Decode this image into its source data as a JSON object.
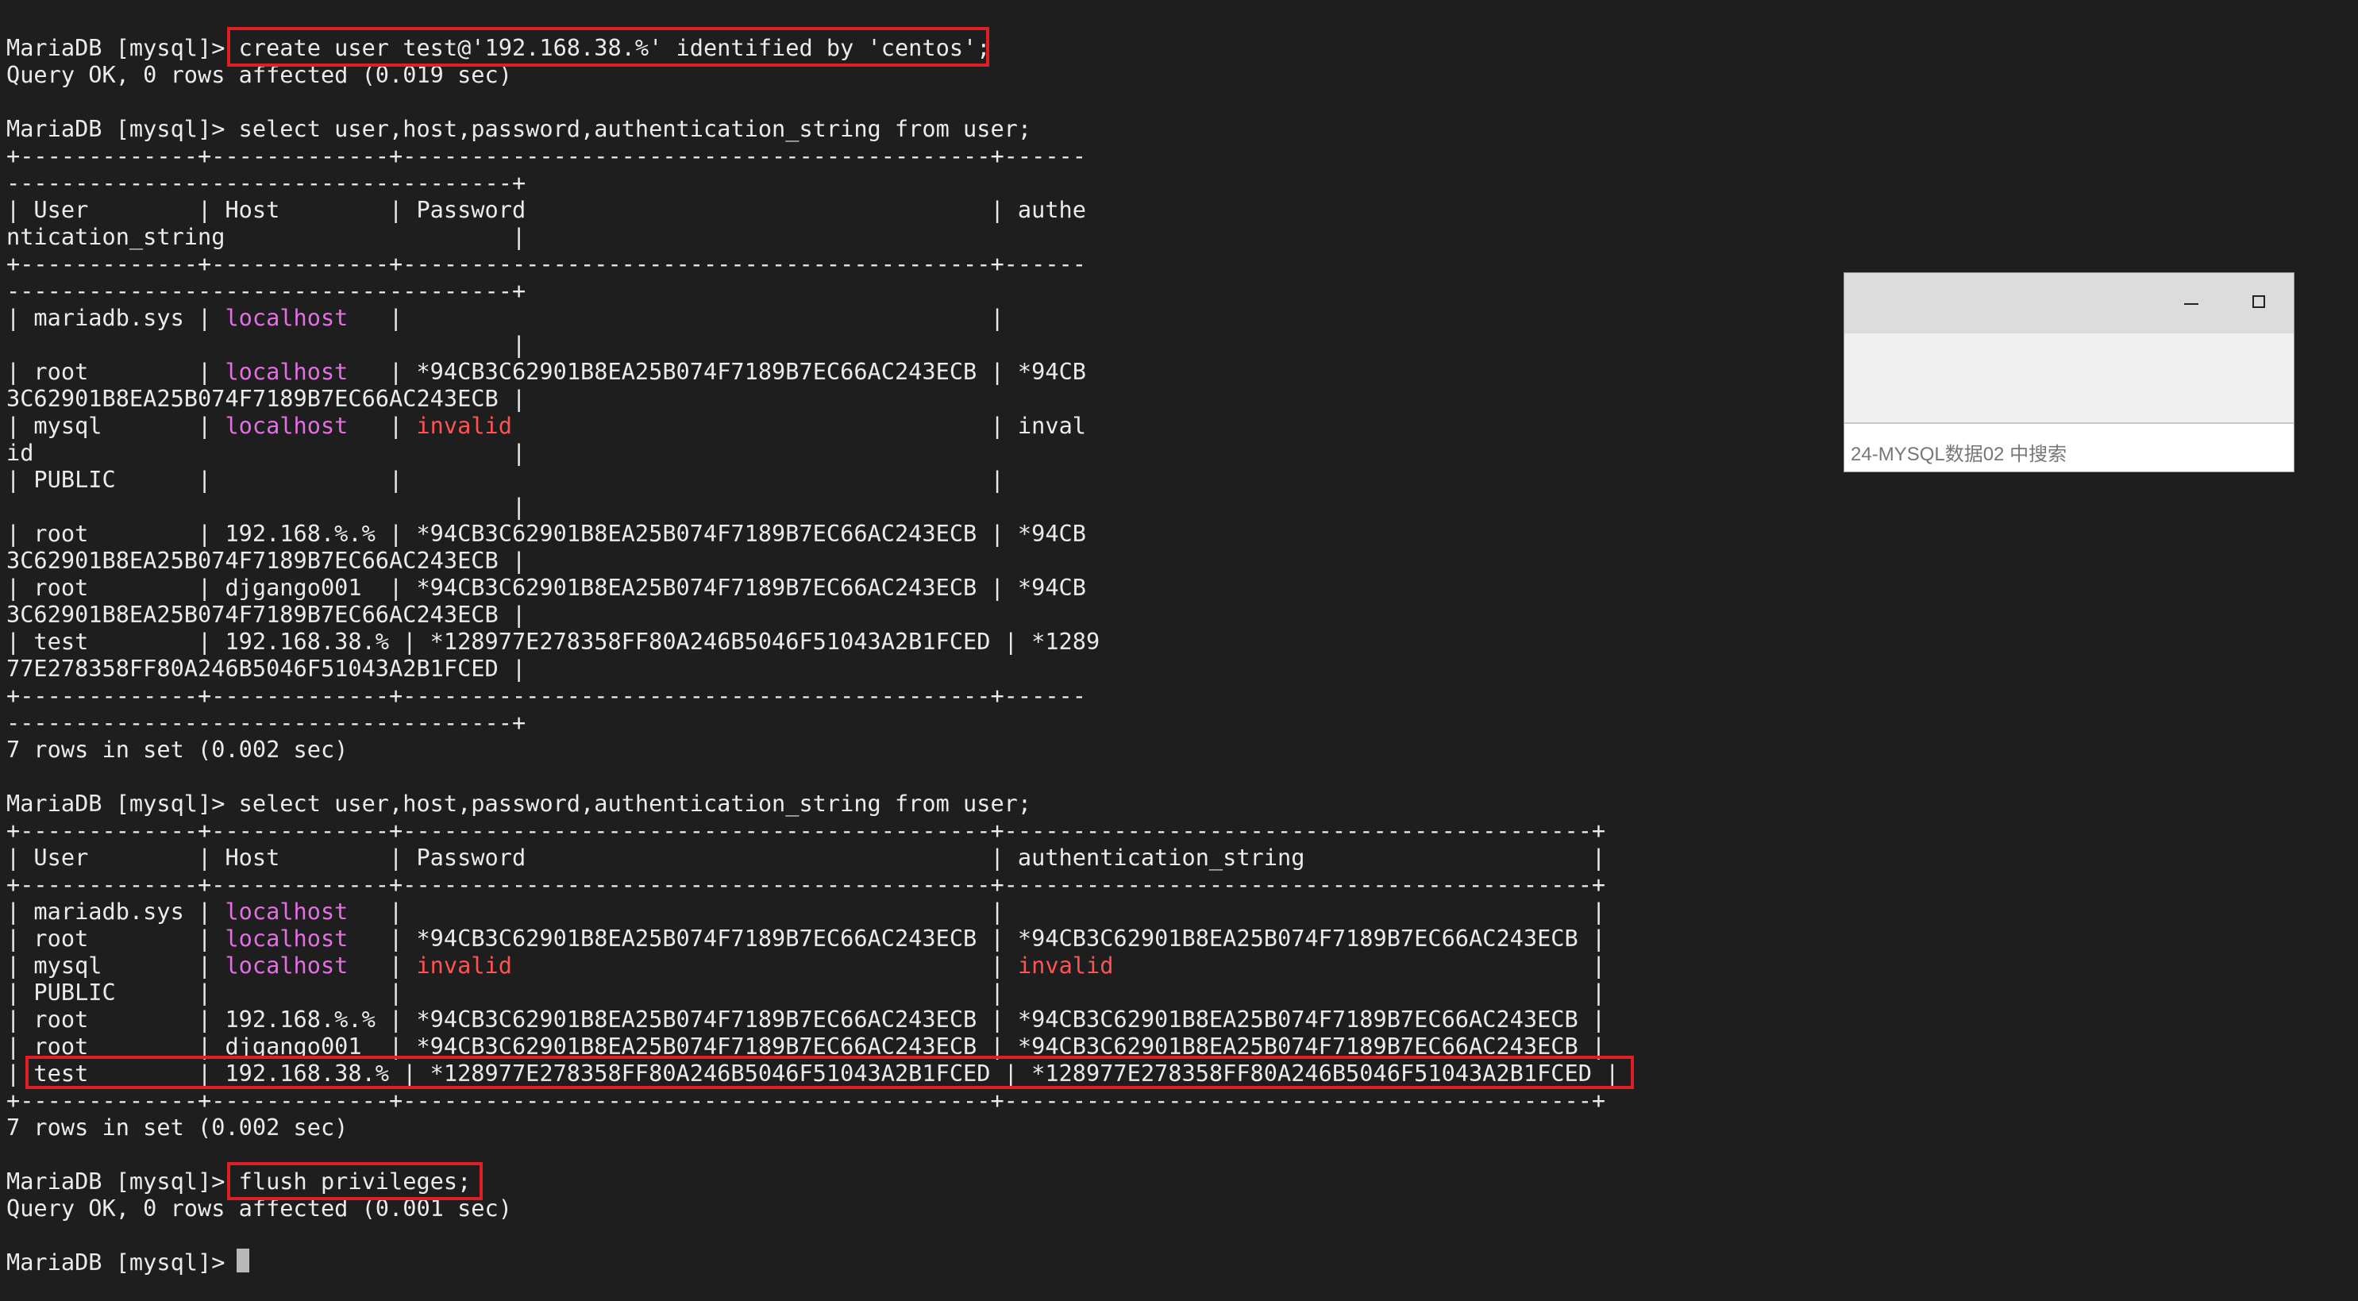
{
  "terminal": {
    "lines": [
      [
        {
          "t": "MariaDB [mysql]> create user test@'192.168.38.%' identified by 'centos';"
        }
      ],
      [
        {
          "t": "Query OK, 0 rows affected (0.019 sec)"
        }
      ],
      [
        {
          "t": ""
        }
      ],
      [
        {
          "t": "MariaDB [mysql]> select user,host,password,authentication_string from user;"
        }
      ],
      [
        {
          "t": "+-------------+-------------+-------------------------------------------+------"
        }
      ],
      [
        {
          "t": "-------------------------------------+"
        }
      ],
      [
        {
          "t": "| User        | Host        | Password                                  | authe"
        }
      ],
      [
        {
          "t": "ntication_string                     |"
        }
      ],
      [
        {
          "t": "+-------------+-------------+-------------------------------------------+------"
        }
      ],
      [
        {
          "t": "-------------------------------------+"
        }
      ],
      [
        {
          "t": "| mariadb.sys | "
        },
        {
          "t": "localhost",
          "c": "m"
        },
        {
          "t": "   |                                           |"
        }
      ],
      [
        {
          "t": "                                     |"
        }
      ],
      [
        {
          "t": "| root        | "
        },
        {
          "t": "localhost",
          "c": "m"
        },
        {
          "t": "   | *94CB3C62901B8EA25B074F7189B7EC66AC243ECB | *94CB"
        }
      ],
      [
        {
          "t": "3C62901B8EA25B074F7189B7EC66AC243ECB |"
        }
      ],
      [
        {
          "t": "| mysql       | "
        },
        {
          "t": "localhost",
          "c": "m"
        },
        {
          "t": "   | "
        },
        {
          "t": "invalid",
          "c": "r"
        },
        {
          "t": "                                   | inval"
        }
      ],
      [
        {
          "t": "id                                   |"
        }
      ],
      [
        {
          "t": "| PUBLIC      |             |                                           |"
        }
      ],
      [
        {
          "t": "                                     |"
        }
      ],
      [
        {
          "t": "| root        | 192.168.%.% | *94CB3C62901B8EA25B074F7189B7EC66AC243ECB | *94CB"
        }
      ],
      [
        {
          "t": "3C62901B8EA25B074F7189B7EC66AC243ECB |"
        }
      ],
      [
        {
          "t": "| root        | djgango001  | *94CB3C62901B8EA25B074F7189B7EC66AC243ECB | *94CB"
        }
      ],
      [
        {
          "t": "3C62901B8EA25B074F7189B7EC66AC243ECB |"
        }
      ],
      [
        {
          "t": "| test        | 192.168.38.% | *128977E278358FF80A246B5046F51043A2B1FCED | *1289"
        }
      ],
      [
        {
          "t": "77E278358FF80A246B5046F51043A2B1FCED |"
        }
      ],
      [
        {
          "t": "+-------------+-------------+-------------------------------------------+------"
        }
      ],
      [
        {
          "t": "-------------------------------------+"
        }
      ],
      [
        {
          "t": "7 rows in set (0.002 sec)"
        }
      ],
      [
        {
          "t": ""
        }
      ],
      [
        {
          "t": "MariaDB [mysql]> select user,host,password,authentication_string from user;"
        }
      ],
      [
        {
          "t": "+-------------+-------------+-------------------------------------------+-------------------------------------------+"
        }
      ],
      [
        {
          "t": "| User        | Host        | Password                                  | authentication_string                     |"
        }
      ],
      [
        {
          "t": "+-------------+-------------+-------------------------------------------+-------------------------------------------+"
        }
      ],
      [
        {
          "t": "| mariadb.sys | "
        },
        {
          "t": "localhost",
          "c": "m"
        },
        {
          "t": "   |                                           |                                           |"
        }
      ],
      [
        {
          "t": "| root        | "
        },
        {
          "t": "localhost",
          "c": "m"
        },
        {
          "t": "   | *94CB3C62901B8EA25B074F7189B7EC66AC243ECB | *94CB3C62901B8EA25B074F7189B7EC66AC243ECB |"
        }
      ],
      [
        {
          "t": "| mysql       | "
        },
        {
          "t": "localhost",
          "c": "m"
        },
        {
          "t": "   | "
        },
        {
          "t": "invalid",
          "c": "r"
        },
        {
          "t": "                                   | "
        },
        {
          "t": "invalid",
          "c": "r"
        },
        {
          "t": "                                   |"
        }
      ],
      [
        {
          "t": "| PUBLIC      |             |                                           |                                           |"
        }
      ],
      [
        {
          "t": "| root        | 192.168.%.% | *94CB3C62901B8EA25B074F7189B7EC66AC243ECB | *94CB3C62901B8EA25B074F7189B7EC66AC243ECB |"
        }
      ],
      [
        {
          "t": "| root        | djgango001  | *94CB3C62901B8EA25B074F7189B7EC66AC243ECB | *94CB3C62901B8EA25B074F7189B7EC66AC243ECB |"
        }
      ],
      [
        {
          "t": "| test        | 192.168.38.% | *128977E278358FF80A246B5046F51043A2B1FCED | *128977E278358FF80A246B5046F51043A2B1FCED |"
        }
      ],
      [
        {
          "t": "+-------------+-------------+-------------------------------------------+-------------------------------------------+"
        }
      ],
      [
        {
          "t": "7 rows in set (0.002 sec)"
        }
      ],
      [
        {
          "t": ""
        }
      ],
      [
        {
          "t": "MariaDB [mysql]> flush privileges;"
        }
      ],
      [
        {
          "t": "Query OK, 0 rows affected (0.001 sec)"
        }
      ],
      [
        {
          "t": ""
        }
      ],
      [
        {
          "t": "MariaDB [mysql]> "
        }
      ]
    ]
  },
  "colors": {
    "background": "#1e1e1e",
    "text": "#ebebeb",
    "host_magenta": "#e56ee5",
    "invalid_red": "#ff5353",
    "highlight_box": "#e01e26"
  },
  "popup": {
    "search_text": "24-MYSQL数据02 中搜索",
    "minimize_icon": "minimize-icon",
    "maximize_icon": "maximize-icon"
  }
}
